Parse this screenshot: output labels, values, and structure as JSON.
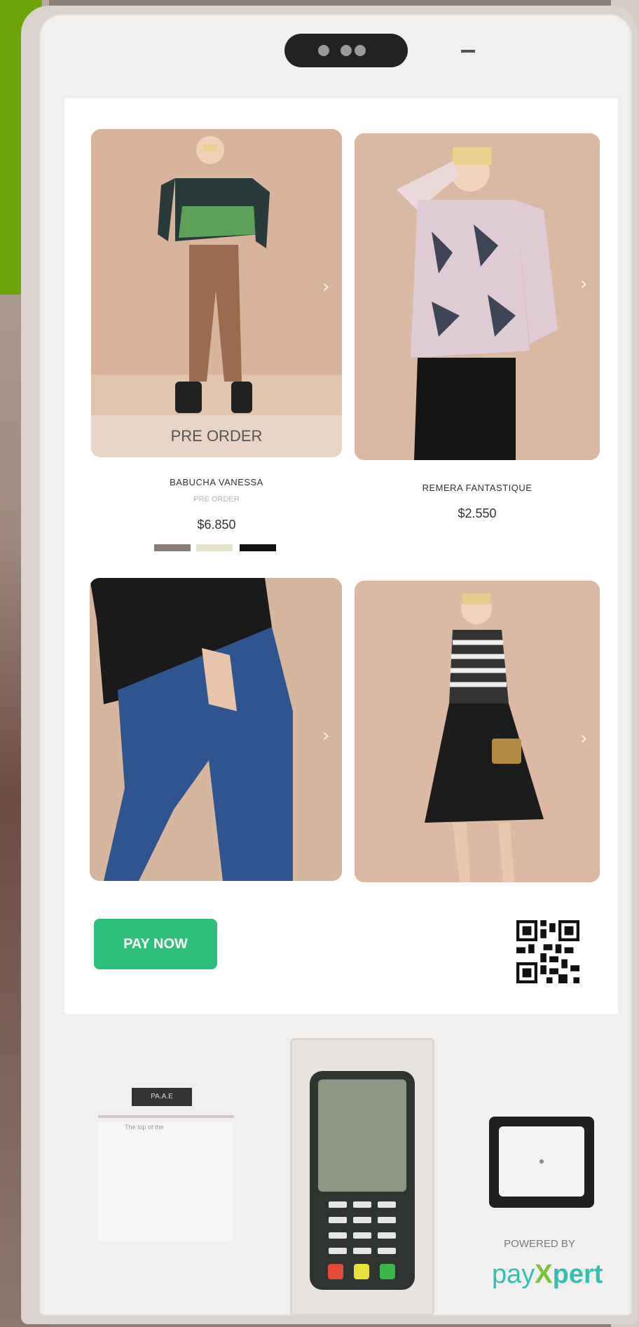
{
  "products": [
    {
      "name": "BABUCHA VANESSA",
      "badge": "PRE ORDER",
      "price": "$6.850",
      "overlay": "PRE ORDER",
      "swatches": [
        "#8a7b73",
        "#e7e4cc",
        "#111111"
      ]
    },
    {
      "name": "REMERA FANTASTIQUE",
      "price": "$2.550"
    },
    {
      "name": "",
      "price": ""
    },
    {
      "name": "",
      "price": ""
    }
  ],
  "pay_button_label": "PAY NOW",
  "footer": {
    "printer_label": "PA.A.E",
    "printer_note": "The top of the",
    "powered_by": "POWERED BY",
    "brand": {
      "part1": "pay",
      "part2": "X",
      "part3": "pert"
    }
  },
  "colors": {
    "accent": "#2ebf7b",
    "screen": "#ffffff",
    "brand_teal": "#35bfb3",
    "brand_green": "#7dc23a"
  },
  "icons": [
    "chevron-right-icon",
    "qr-code-icon",
    "nfc-reader-icon"
  ]
}
